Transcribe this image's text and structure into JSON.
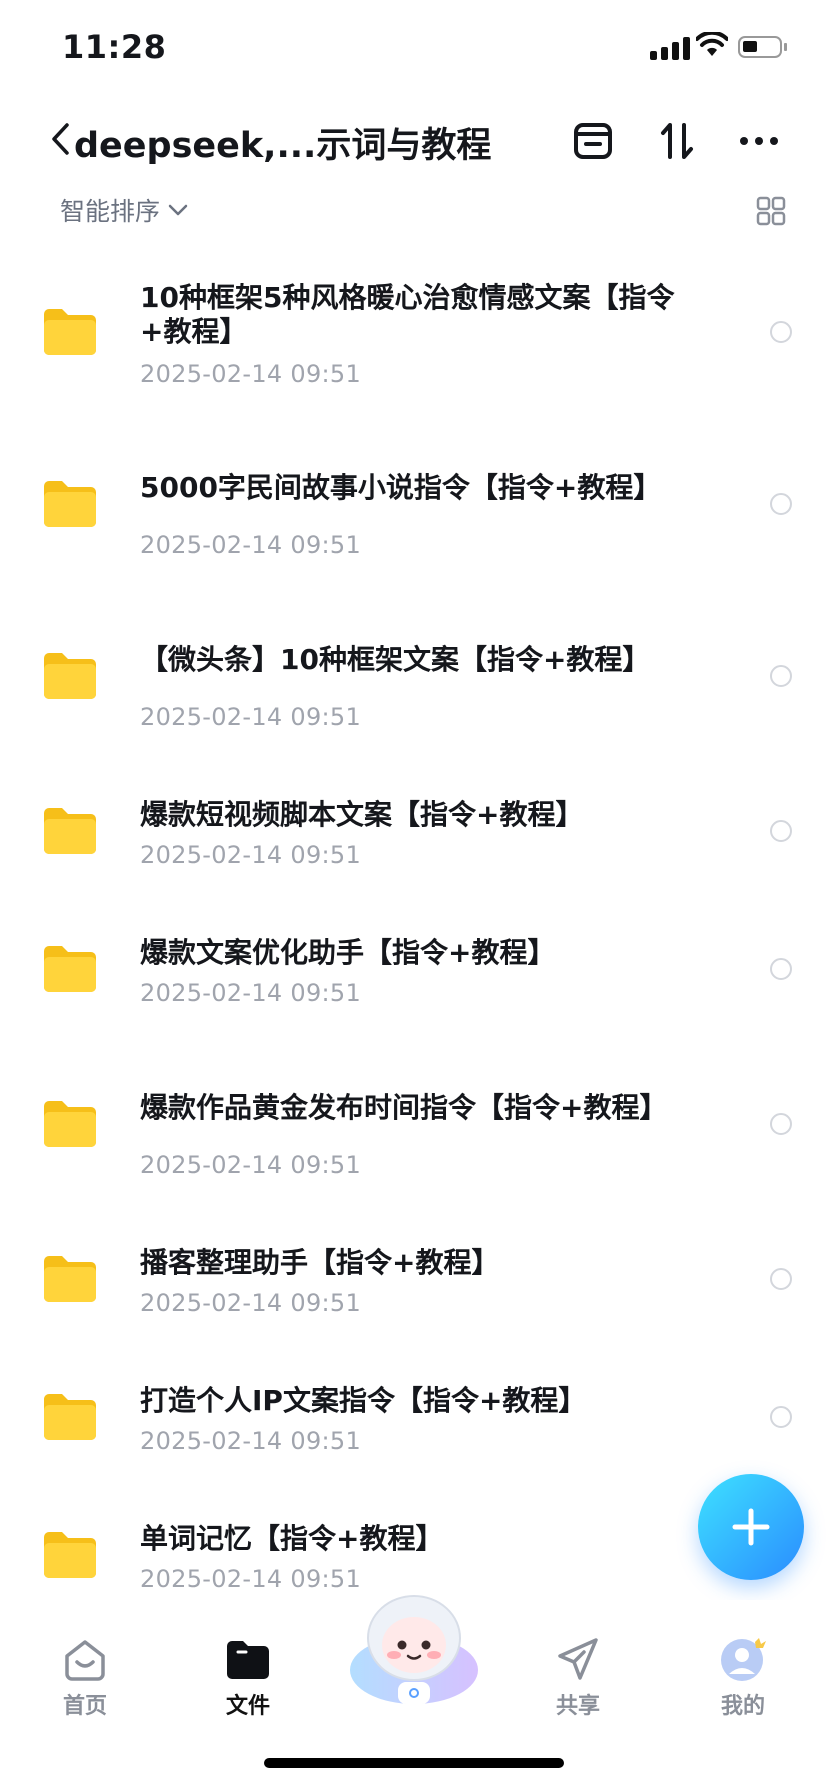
{
  "status_bar": {
    "time": "11:28"
  },
  "header": {
    "title": "deepseek,...示词与教程"
  },
  "sort": {
    "label": "智能排序"
  },
  "files": [
    {
      "name": "10种框架5种风格暖心治愈情感文案【指令+教程】",
      "date": "2025-02-14 09:51"
    },
    {
      "name": "5000字民间故事小说指令【指令+教程】",
      "date": "2025-02-14 09:51"
    },
    {
      "name": "【微头条】10种框架文案【指令+教程】",
      "date": "2025-02-14 09:51"
    },
    {
      "name": "爆款短视频脚本文案【指令+教程】",
      "date": "2025-02-14 09:51"
    },
    {
      "name": "爆款文案优化助手【指令+教程】",
      "date": "2025-02-14 09:51"
    },
    {
      "name": "爆款作品黄金发布时间指令【指令+教程】",
      "date": "2025-02-14 09:51"
    },
    {
      "name": "播客整理助手【指令+教程】",
      "date": "2025-02-14 09:51"
    },
    {
      "name": "打造个人IP文案指令【指令+教程】",
      "date": "2025-02-14 09:51"
    },
    {
      "name": "单词记忆【指令+教程】",
      "date": "2025-02-14 09:51"
    }
  ],
  "tabbar": {
    "home": "首页",
    "files": "文件",
    "share": "共享",
    "mine": "我的"
  },
  "colors": {
    "folder": "#FFD43B",
    "fab_start": "#3EE1FF",
    "fab_end": "#2A8CFF",
    "date_text": "#A0A4AD"
  }
}
